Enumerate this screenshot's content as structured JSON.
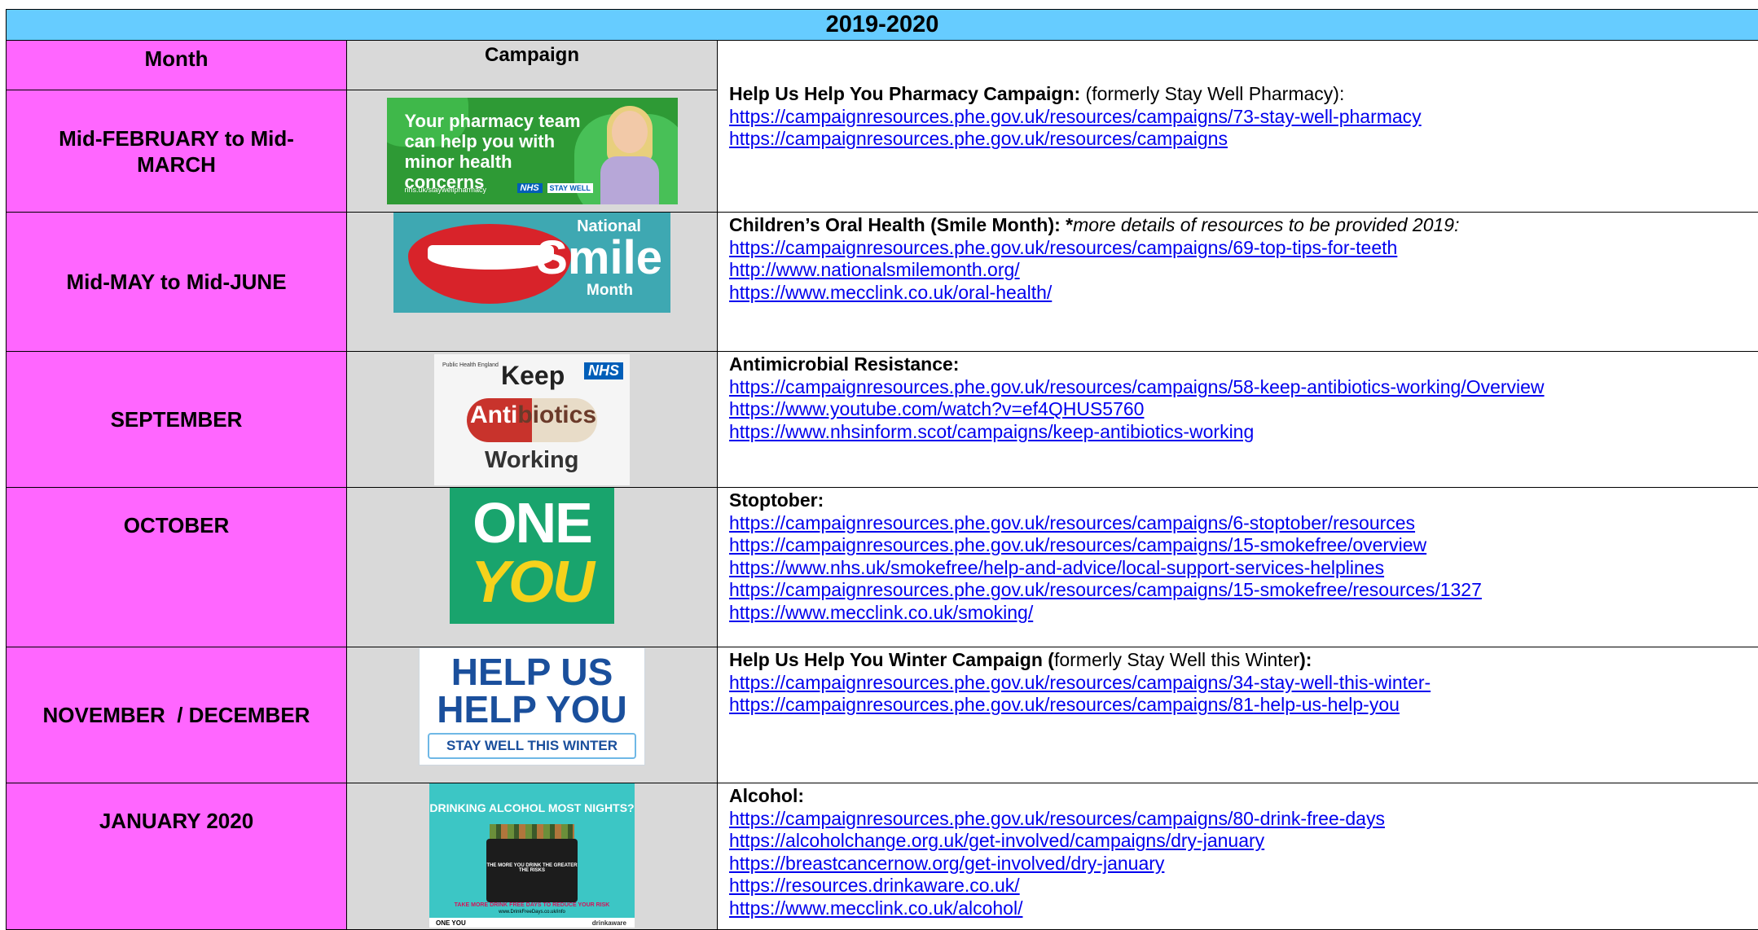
{
  "year": "2019-2020",
  "headers": {
    "month": "Month",
    "campaign": "Campaign"
  },
  "rows": [
    {
      "month": "Mid-FEBRUARY to Mid-MARCH",
      "image": {
        "headline": "Your pharmacy team can help you with minor health concerns",
        "url": "nhs.uk/staywellpharmacy",
        "nhs": "NHS",
        "badge": "STAY WELL"
      },
      "title_bold": "Help Us Help You Pharmacy Campaign:",
      "title_rest": " (formerly Stay Well Pharmacy):",
      "links": [
        "https://campaignresources.phe.gov.uk/resources/campaigns/73-stay-well-pharmacy",
        "https://campaignresources.phe.gov.uk/resources/campaigns"
      ]
    },
    {
      "month": "Mid-MAY to Mid-JUNE",
      "image": {
        "national": "National",
        "smile": "Smile",
        "month": "Month"
      },
      "title_bold": "Children’s Oral Health (Smile Month): *",
      "title_rest": "more details of resources to be provided 2019:",
      "links": [
        "https://campaignresources.phe.gov.uk/resources/campaigns/69-top-tips-for-teeth",
        "http://www.nationalsmilemonth.org/",
        "https://www.mecclink.co.uk/oral-health/"
      ]
    },
    {
      "month": "SEPTEMBER",
      "image": {
        "phe": "Public Health England",
        "keep": "Keep",
        "nhs": "NHS",
        "anti": "Anti",
        "biotics": "biotics",
        "working": "Working"
      },
      "title_bold": "Antimicrobial Resistance:",
      "title_rest": "",
      "links": [
        "https://campaignresources.phe.gov.uk/resources/campaigns/58-keep-antibiotics-working/Overview",
        "https://www.youtube.com/watch?v=ef4QHUS5760",
        "https://www.nhsinform.scot/campaigns/keep-antibiotics-working"
      ]
    },
    {
      "month": "OCTOBER",
      "image": {
        "one": "ONE",
        "you": "YOU"
      },
      "title_bold": "Stoptober:",
      "title_rest": "",
      "links": [
        "https://campaignresources.phe.gov.uk/resources/campaigns/6-stoptober/resources",
        "https://campaignresources.phe.gov.uk/resources/campaigns/15-smokefree/overview",
        "https://www.nhs.uk/smokefree/help-and-advice/local-support-services-helplines",
        "https://campaignresources.phe.gov.uk/resources/campaigns/15-smokefree/resources/1327",
        "https://www.mecclink.co.uk/smoking/"
      ]
    },
    {
      "month": "NOVEMBER  / DECEMBER",
      "image": {
        "line1": "HELP US",
        "line2": "HELP YOU",
        "bar": "STAY WELL THIS WINTER"
      },
      "title_bold": "Help Us Help You Winter Campaign (",
      "title_rest": "formerly Stay Well this Winter",
      "title_end": "):",
      "links": [
        "https://campaignresources.phe.gov.uk/resources/campaigns/34-stay-well-this-winter-",
        "https://campaignresources.phe.gov.uk/resources/campaigns/81-help-us-help-you"
      ]
    },
    {
      "month": "JANUARY 2020",
      "image": {
        "title": "DRINKING ALCOHOL MOST NIGHTS?",
        "crate": "THE MORE YOU DRINK THE GREATER THE RISKS",
        "bottom": "TAKE MORE DRINK FREE DAYS TO REDUCE YOUR RISK",
        "web": "www.DrinkFreeDays.co.uk/info",
        "oneyou": "ONE YOU",
        "drinkaware": "drinkaware"
      },
      "title_bold": "Alcohol:",
      "title_rest": "",
      "links": [
        "https://campaignresources.phe.gov.uk/resources/campaigns/80-drink-free-days",
        "https://alcoholchange.org.uk/get-involved/campaigns/dry-january",
        "https://breastcancernow.org/get-involved/dry-january",
        "https://resources.drinkaware.co.uk/",
        "https://www.mecclink.co.uk/alcohol/"
      ]
    }
  ]
}
